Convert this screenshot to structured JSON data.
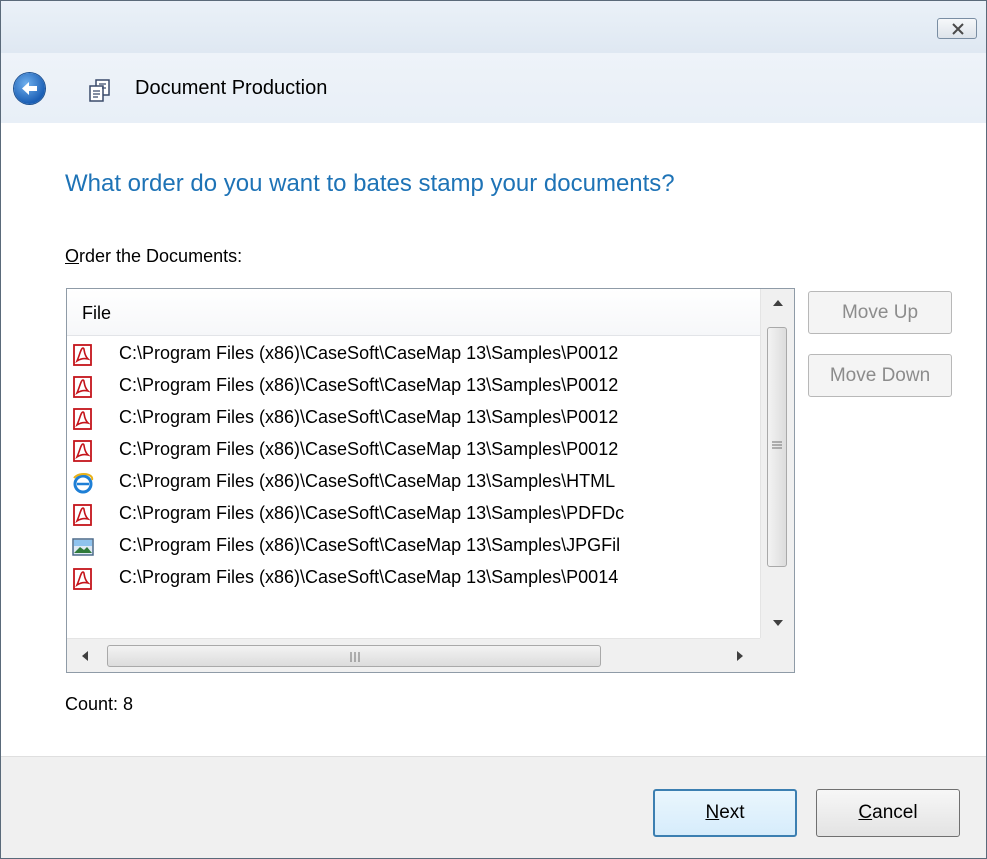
{
  "header": {
    "title": "Document Production"
  },
  "question": "What order do you want to bates stamp your documents?",
  "order_label": {
    "mnemonic": "O",
    "rest": "rder the Documents:"
  },
  "list": {
    "column_header": "File",
    "rows": [
      {
        "icon": "pdf-icon",
        "path": "C:\\Program Files (x86)\\CaseSoft\\CaseMap 13\\Samples\\P0012"
      },
      {
        "icon": "pdf-icon",
        "path": "C:\\Program Files (x86)\\CaseSoft\\CaseMap 13\\Samples\\P0012"
      },
      {
        "icon": "pdf-icon",
        "path": "C:\\Program Files (x86)\\CaseSoft\\CaseMap 13\\Samples\\P0012"
      },
      {
        "icon": "pdf-icon",
        "path": "C:\\Program Files (x86)\\CaseSoft\\CaseMap 13\\Samples\\P0012"
      },
      {
        "icon": "ie-html-icon",
        "path": "C:\\Program Files (x86)\\CaseSoft\\CaseMap 13\\Samples\\HTML"
      },
      {
        "icon": "pdf-icon",
        "path": "C:\\Program Files (x86)\\CaseSoft\\CaseMap 13\\Samples\\PDFDc"
      },
      {
        "icon": "image-icon",
        "path": "C:\\Program Files (x86)\\CaseSoft\\CaseMap 13\\Samples\\JPGFil"
      },
      {
        "icon": "pdf-icon",
        "path": "C:\\Program Files (x86)\\CaseSoft\\CaseMap 13\\Samples\\P0014"
      }
    ]
  },
  "side_buttons": {
    "move_up": "Move Up",
    "move_down": "Move Down"
  },
  "count": "Count: 8",
  "footer": {
    "next": {
      "mnemonic": "N",
      "rest": "ext"
    },
    "cancel": {
      "mnemonic": "C",
      "rest": "ancel"
    }
  },
  "colors": {
    "question": "#1e73b6",
    "pdf": "#c4141b",
    "disabled_text": "#8c8c8c"
  }
}
